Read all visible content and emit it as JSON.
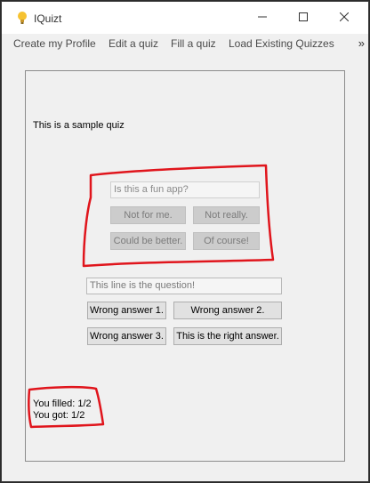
{
  "window": {
    "title": "IQuizt",
    "icon": "lightbulb-icon",
    "controls": [
      "minimize-icon",
      "maximize-icon",
      "close-icon"
    ]
  },
  "menu": {
    "items": [
      "Create my Profile",
      "Edit a quiz",
      "Fill a quiz",
      "Load Existing Quizzes"
    ],
    "overflow": "»"
  },
  "quiz": {
    "title": "This is a sample quiz",
    "questions": [
      {
        "question": "Is this a fun app?",
        "answers": [
          "Not for me.",
          "Not really.",
          "Could be better.",
          "Of course!"
        ],
        "state": "disabled"
      },
      {
        "question": "This line is the question!",
        "answers": [
          "Wrong answer 1.",
          "Wrong answer 2.",
          "Wrong answer 3.",
          "This is the right answer."
        ],
        "state": "enabled"
      }
    ]
  },
  "score": {
    "filled": "You filled: 1/2",
    "got": "You got: 1/2"
  },
  "colors": {
    "window_bg": "#f0f0f0",
    "annotation_red": "#e0151c",
    "disabled_button": "#cccccc",
    "enabled_button": "#e1e1e1"
  }
}
